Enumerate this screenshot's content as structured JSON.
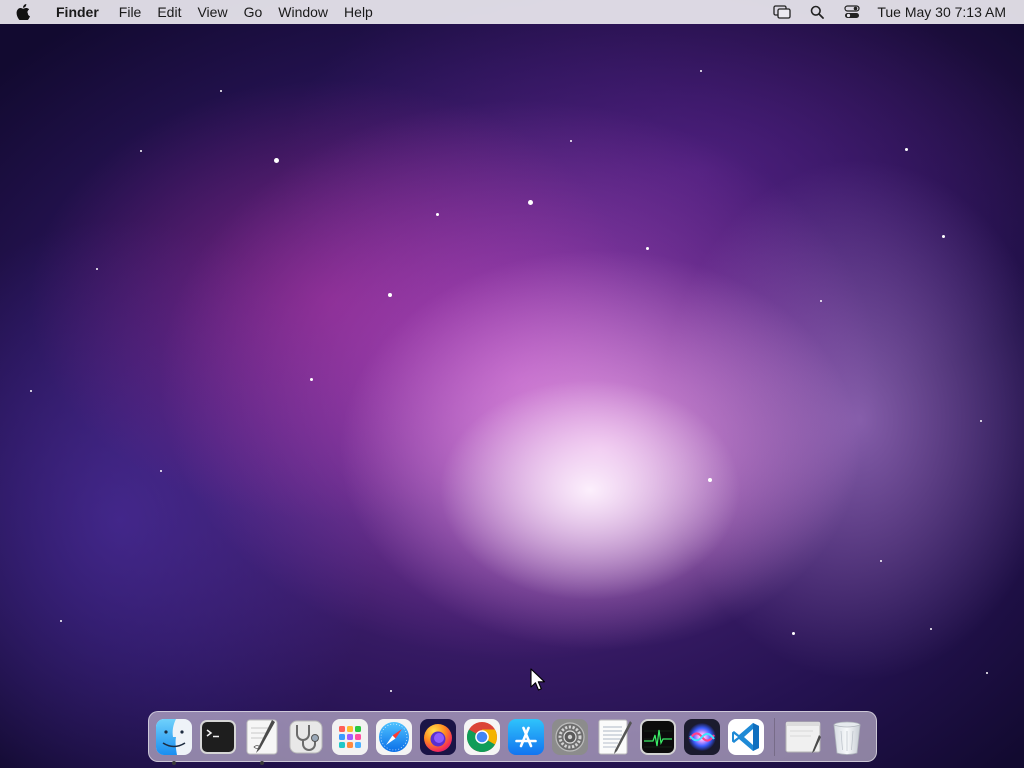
{
  "menubar": {
    "app_name": "Finder",
    "items": [
      "File",
      "Edit",
      "View",
      "Go",
      "Window",
      "Help"
    ],
    "clock": "Tue May 30  7:13 AM",
    "status_icons": [
      "screen-mirroring-icon",
      "spotlight-search-icon",
      "control-center-icon"
    ]
  },
  "dock": {
    "apps": [
      {
        "name": "Finder",
        "icon": "finder-icon",
        "running": true
      },
      {
        "name": "Terminal",
        "icon": "terminal-icon",
        "running": false
      },
      {
        "name": "Script Editor",
        "icon": "script-editor-icon",
        "running": true
      },
      {
        "name": "System Information",
        "icon": "system-information-icon",
        "running": false
      },
      {
        "name": "Launchpad",
        "icon": "launchpad-icon",
        "running": false
      },
      {
        "name": "Safari",
        "icon": "safari-icon",
        "running": false
      },
      {
        "name": "Firefox",
        "icon": "firefox-icon",
        "running": false
      },
      {
        "name": "Google Chrome",
        "icon": "chrome-icon",
        "running": false
      },
      {
        "name": "App Store",
        "icon": "app-store-icon",
        "running": false
      },
      {
        "name": "System Preferences",
        "icon": "system-preferences-icon",
        "running": false
      },
      {
        "name": "TextEdit",
        "icon": "textedit-icon",
        "running": false
      },
      {
        "name": "Activity Monitor",
        "icon": "activity-monitor-icon",
        "running": false
      },
      {
        "name": "Siri",
        "icon": "siri-icon",
        "running": false
      },
      {
        "name": "Visual Studio Code",
        "icon": "vscode-icon",
        "running": false
      }
    ],
    "others": [
      {
        "name": "Documents",
        "icon": "document-stack-icon"
      },
      {
        "name": "Trash",
        "icon": "trash-icon"
      }
    ]
  },
  "colors": {
    "menubar_bg": "#ECE9F0",
    "wallpaper_core": "#F2B8EE",
    "wallpaper_edge": "#120A30"
  }
}
